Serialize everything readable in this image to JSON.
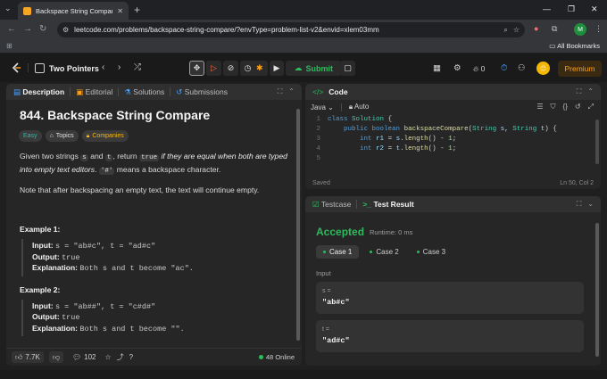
{
  "browser": {
    "tab_title": "Backspace String Compare - Le",
    "url": "leetcode.com/problems/backspace-string-compare/?envType=problem-list-v2&envid=xlem03mm",
    "profile_initial": "M",
    "all_bookmarks": "All Bookmarks"
  },
  "nav": {
    "list_name": "Two Pointers",
    "submit_label": "Submit",
    "streak": "0",
    "premium_label": "Premium"
  },
  "description": {
    "tabs": [
      "Description",
      "Editorial",
      "Solutions",
      "Submissions"
    ],
    "title": "844. Backspace String Compare",
    "tags": [
      "Easy",
      "Topics",
      "Companies"
    ],
    "p1_a": "Given two strings ",
    "p1_s": "s",
    "p1_b": " and ",
    "p1_t": "t",
    "p1_c": ", return ",
    "p1_true": "true",
    "p1_d": " if they are equal when both are typed into empty text editors",
    "p1_e": ". ",
    "p1_hash": "'#'",
    "p1_f": " means a backspace character.",
    "p2": "Note that after backspacing an empty text, the text will continue empty.",
    "examples": [
      {
        "label": "Example 1:",
        "input_label": "Input:",
        "input": "s = \"ab#c\", t = \"ad#c\"",
        "output_label": "Output:",
        "output": "true",
        "explanation_label": "Explanation:",
        "explanation": "Both s and t become \"ac\"."
      },
      {
        "label": "Example 2:",
        "input_label": "Input:",
        "input": "s = \"ab##\", t = \"c#d#\"",
        "output_label": "Output:",
        "output": "true",
        "explanation_label": "Explanation:",
        "explanation": "Both s and t become \"\"."
      }
    ],
    "likes": "7.7K",
    "comments": "102",
    "online": "48 Online"
  },
  "code": {
    "tab": "Code",
    "language": "Java",
    "autosave": "Auto",
    "lines": [
      {
        "n": "1",
        "text": "class Solution {"
      },
      {
        "n": "2",
        "text": "    public boolean backspaceCompare(String s, String t) {"
      },
      {
        "n": "3",
        "text": "        int r1 = s.length() - 1;"
      },
      {
        "n": "4",
        "text": "        int r2 = t.length() - 1;"
      },
      {
        "n": "5",
        "text": ""
      }
    ],
    "saved": "Saved",
    "position": "Ln 50, Col 2"
  },
  "result": {
    "tabs": [
      "Testcase",
      "Test Result"
    ],
    "status": "Accepted",
    "runtime": "Runtime: 0 ms",
    "cases": [
      "Case 1",
      "Case 2",
      "Case 3"
    ],
    "input_label": "Input",
    "inputs": [
      {
        "name": "s =",
        "value": "\"ab#c\""
      },
      {
        "name": "t =",
        "value": "\"ad#c\""
      }
    ]
  },
  "colors": {
    "accent_green": "#2cbb5d",
    "premium_orange": "#ffa116",
    "easy_teal": "#2cbbaa"
  }
}
